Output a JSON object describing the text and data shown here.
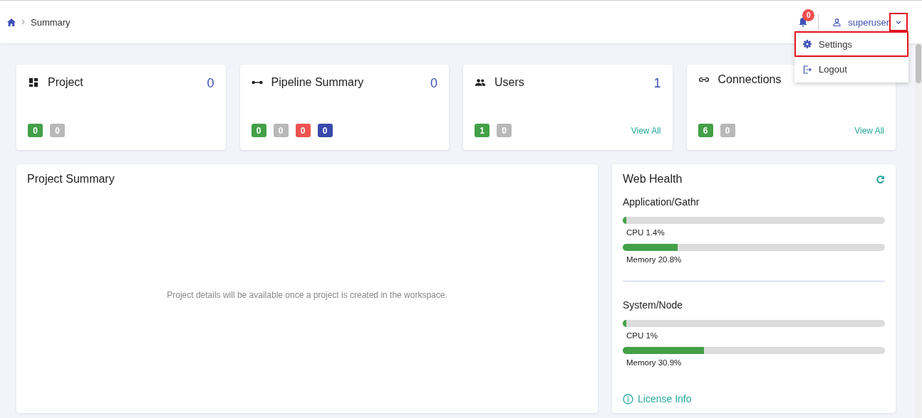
{
  "breadcrumb": {
    "items": [
      "Summary"
    ]
  },
  "header": {
    "notification_count": "0",
    "user": "superuser",
    "chevron_highlighted": true
  },
  "user_menu": {
    "items": [
      {
        "kind": "settings",
        "label": "Settings",
        "highlighted": true
      },
      {
        "kind": "logout",
        "label": "Logout",
        "highlighted": false
      }
    ]
  },
  "cards": [
    {
      "kind": "project",
      "title": "Project",
      "count": "0",
      "badges": [
        {
          "value": "0",
          "color": "#43a047"
        },
        {
          "value": "0",
          "color": "#b8b8b8"
        }
      ]
    },
    {
      "kind": "pipeline",
      "title": "Pipeline Summary",
      "count": "0",
      "badges": [
        {
          "value": "0",
          "color": "#43a047"
        },
        {
          "value": "0",
          "color": "#b8b8b8"
        },
        {
          "value": "0",
          "color": "#ef5350"
        },
        {
          "value": "0",
          "color": "#3949ab"
        }
      ]
    },
    {
      "kind": "users",
      "title": "Users",
      "count": "1",
      "link": "View All",
      "badges": [
        {
          "value": "1",
          "color": "#43a047"
        },
        {
          "value": "0",
          "color": "#b8b8b8"
        }
      ]
    },
    {
      "kind": "connections",
      "title": "Connections",
      "link": "View All",
      "badges": [
        {
          "value": "6",
          "color": "#43a047"
        },
        {
          "value": "0",
          "color": "#b8b8b8"
        }
      ]
    }
  ],
  "project_summary": {
    "title": "Project Summary",
    "message": "Project details will be available once a project is created in the workspace."
  },
  "web_health": {
    "title": "Web Health",
    "groups": [
      {
        "name": "Application/Gathr",
        "meters": [
          {
            "label": "CPU 1.4%",
            "level": 0.014
          },
          {
            "label": "Memory 20.8%",
            "level": 0.208
          }
        ]
      },
      {
        "name": "System/Node",
        "meters": [
          {
            "label": "CPU 1%",
            "level": 0.01
          },
          {
            "label": "Memory 30.9%",
            "level": 0.309
          }
        ]
      }
    ],
    "link": "License Info"
  }
}
